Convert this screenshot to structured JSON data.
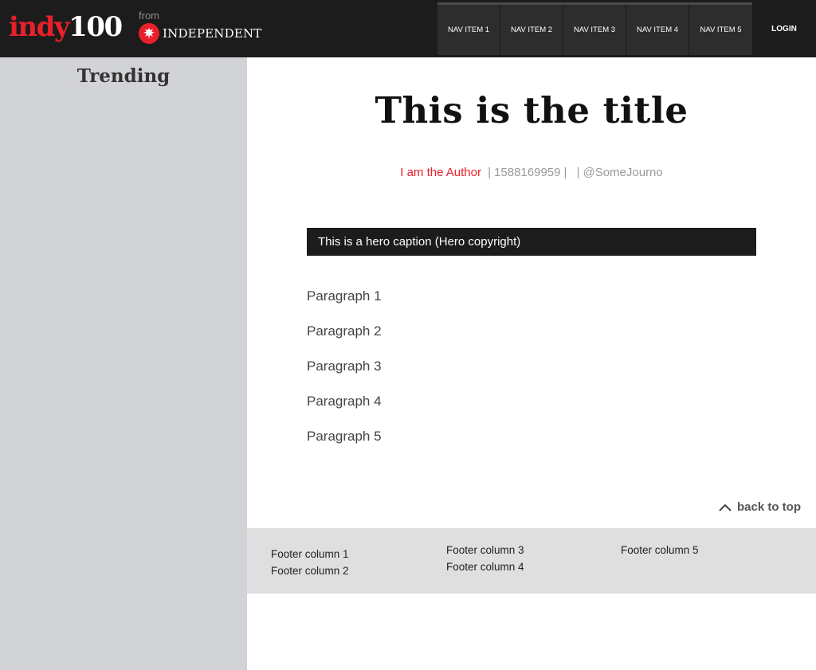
{
  "header": {
    "logo_part1": "indy",
    "logo_part2": "100",
    "from_label": "from",
    "publisher_name": "INDEPENDENT",
    "nav_items": [
      {
        "label": "NAV ITEM 1"
      },
      {
        "label": "NAV ITEM 2"
      },
      {
        "label": "NAV ITEM 3"
      },
      {
        "label": "NAV ITEM 4"
      },
      {
        "label": "NAV ITEM 5"
      }
    ],
    "login_label": "LOGIN"
  },
  "sidebar": {
    "title": "Trending"
  },
  "article": {
    "title": "This is the title",
    "author": "I am the Author",
    "timestamp": "1588169959",
    "twitter": "@SomeJourno",
    "hero_caption": "This is a hero caption (Hero copyright)",
    "paragraphs": [
      "Paragraph 1",
      "Paragraph 2",
      "Paragraph 3",
      "Paragraph 4",
      "Paragraph 5"
    ],
    "back_to_top": "back to top"
  },
  "footer": {
    "columns": [
      "Footer column 1",
      "Footer column 2",
      "Footer column 3",
      "Footer column 4",
      "Footer column 5"
    ]
  },
  "colors": {
    "brand_red": "#e8202a",
    "header_bg": "#1c1c1c",
    "sidebar_bg": "#d2d3d7",
    "footer_bg": "#dfdfdf"
  },
  "icons": [
    "eagle-icon",
    "chevron-up-icon"
  ]
}
